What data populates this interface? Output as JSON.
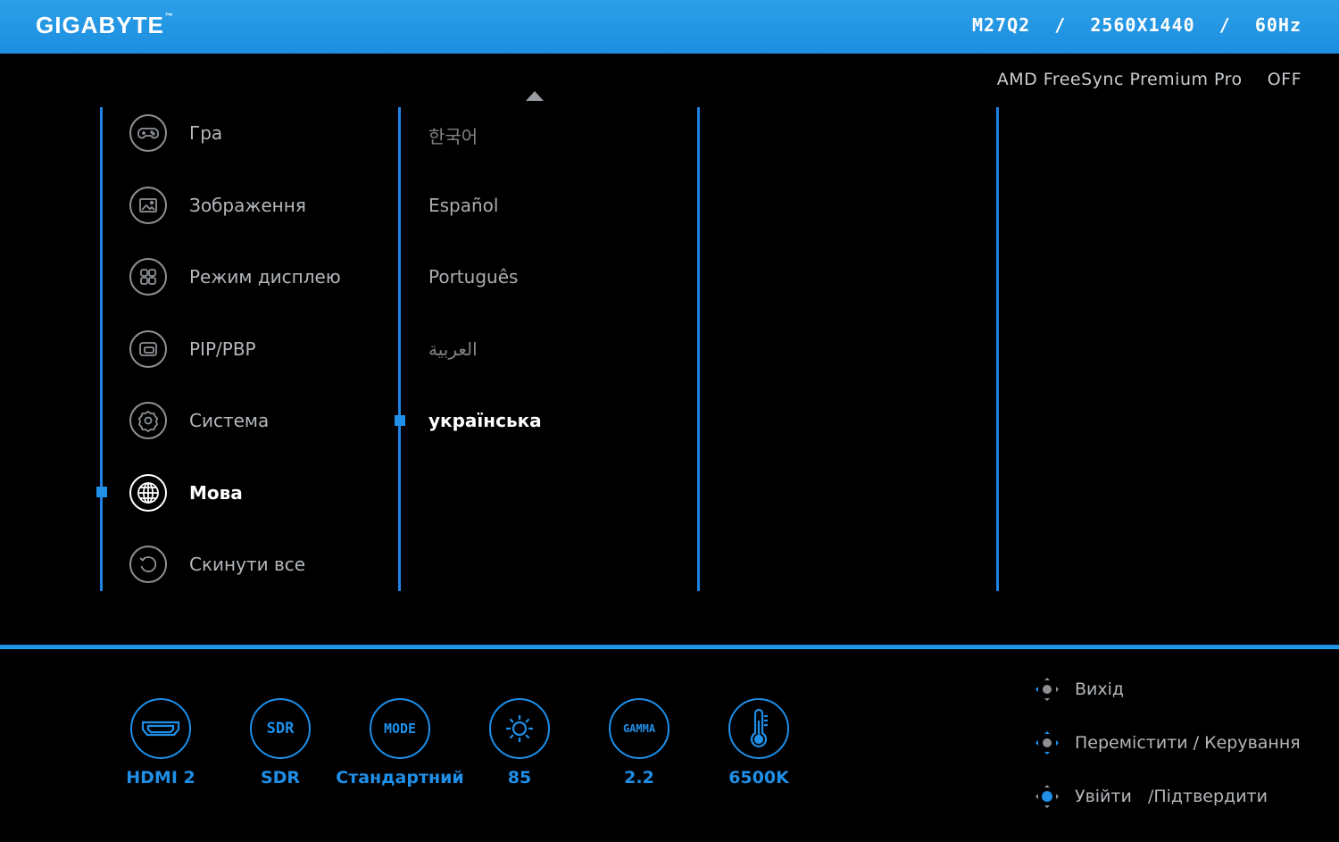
{
  "header": {
    "brand": "GIGABYTE",
    "brand_tm": "™",
    "model": "M27Q2",
    "resolution": "2560X1440",
    "refresh_rate": "60Hz",
    "separator": "/"
  },
  "freesync": {
    "label": "AMD FreeSync Premium Pro",
    "value": "OFF"
  },
  "main_menu": {
    "items": [
      {
        "label": "Гра",
        "icon": "gamepad-icon"
      },
      {
        "label": "Зображення",
        "icon": "picture-icon"
      },
      {
        "label": "Режим дисплею",
        "icon": "grid-icon"
      },
      {
        "label": "PIP/PBP",
        "icon": "pip-icon"
      },
      {
        "label": "Система",
        "icon": "gear-icon"
      },
      {
        "label": "Мова",
        "icon": "globe-icon"
      },
      {
        "label": "Скинути все",
        "icon": "reset-icon"
      }
    ],
    "selected": "Мова"
  },
  "language_menu": {
    "items": [
      "한국어",
      "Español",
      "Português",
      "العربية",
      "українська"
    ],
    "selected": "українська"
  },
  "status_bar": {
    "items": [
      {
        "icon_text": "",
        "icon": "hdmi-icon",
        "label": "HDMI 2"
      },
      {
        "icon_text": "SDR",
        "icon": "sdr-icon",
        "label": "SDR"
      },
      {
        "icon_text": "MODE",
        "icon": "mode-icon",
        "label": "Стандартний"
      },
      {
        "icon_text": "",
        "icon": "brightness-icon",
        "label": "85"
      },
      {
        "icon_text": "GAMMA",
        "icon": "gamma-icon",
        "label": "2.2"
      },
      {
        "icon_text": "",
        "icon": "thermometer-icon",
        "label": "6500K"
      }
    ]
  },
  "controls": {
    "items": [
      {
        "label": "Вихід",
        "icon": "joystick-left-icon"
      },
      {
        "label": "Перемістити / Керування",
        "icon": "joystick-move-icon"
      },
      {
        "label": "Увійти   /Підтвердити",
        "icon": "joystick-press-icon"
      }
    ]
  },
  "colors": {
    "accent": "#1f8fe8",
    "header": "#1b8ee0",
    "background": "#000000"
  }
}
